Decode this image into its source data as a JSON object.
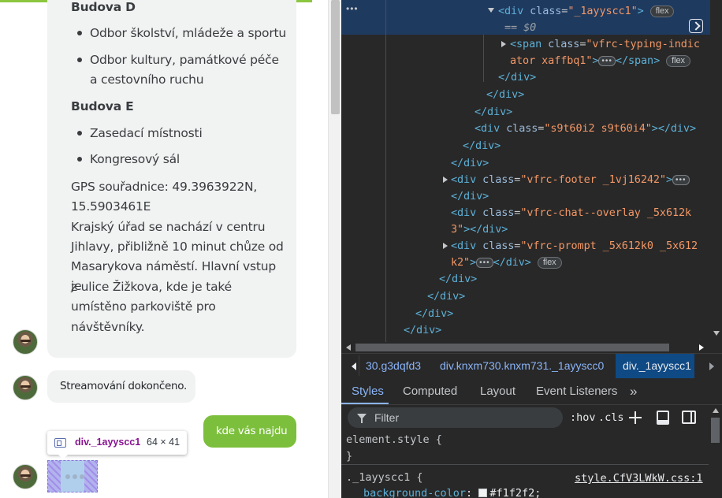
{
  "chat": {
    "bubble1": {
      "heading_d": "Budova D",
      "d_items": [
        "Odbor školství, mládeže a sportu",
        "Odbor kultury, památkové péče",
        "a cestovního ruchu"
      ],
      "heading_e": "Budova E",
      "e_items": [
        "Zasedací místnosti",
        "Kongresový sál"
      ],
      "paragraph_lines": [
        "GPS souřadnice: 49.3963922N,",
        "15.5903461E",
        "Krajský úřad se nachází v centru",
        "Jihlavy, přibližně 10 minut chůze od",
        "Masarykova náměstí. Hlavní vstup je",
        "z ulice Žižkova, kde je také",
        "umístěno parkoviště pro",
        "návštěvníky."
      ]
    },
    "bubble2": "Streamování dokončeno.",
    "user_message": "kde vás najdu",
    "tooltip": {
      "name": "div._1ayyscc1",
      "size": "64 × 41"
    }
  },
  "devtools": {
    "dom": {
      "l1_tag_open": "<div ",
      "l1_attr": "class",
      "l1_val": "\"_1ayyscc1\"",
      "l1_close": ">",
      "l1_badge": "flex",
      "l2": "== $0",
      "l3_open": "<span ",
      "l3_attr": "class",
      "l3_val": "\"vfrc-typing-indic",
      "l4_val": "ator xaffbq1\"",
      "l4_close": "</span>",
      "l4_badge": "flex",
      "close_div": "</div>",
      "l10_open": "<div ",
      "l10_attr": "class",
      "l10_val": "\"s9t60i2 s9t60i4\"",
      "l10_close": "></div>",
      "l13_val": "\"vfrc-footer _1vj16242\"",
      "l15_val": "\"vfrc-chat--overlay _5x612k",
      "l16_val": "3\"",
      "l16_close": "></div>",
      "l17_val": "\"vfrc-prompt _5x612k0 _5x612",
      "l18_val": "k2\"",
      "l18_close": "</div>",
      "l18_badge": "flex",
      "ellipsis_badge": "•••",
      "gutter_ellipsis": "•••"
    },
    "breadcrumbs": [
      "30.g3dqfd3",
      "div.knxm730.knxm731._1ayyscc0",
      "div._1ayyscc1"
    ],
    "tabs": {
      "styles": "Styles",
      "computed": "Computed",
      "layout": "Layout",
      "events": "Event Listeners",
      "more": "»"
    },
    "toolbar": {
      "filter_placeholder": "Filter",
      "hov": ":hov",
      "cls": ".cls"
    },
    "styles": {
      "element_style": "element.style {",
      "element_close": "}",
      "rule_selector": "._1ayyscc1 {",
      "rule_source": "style.CfV3LWkW.css:1",
      "prop_name": "background-color",
      "prop_value": "#f1f2f2;"
    },
    "colors": {
      "selected_row": "#1f3a5f",
      "accent_blue": "#8ab4f8",
      "chat_green": "#7cbf3c",
      "bubble_gray": "#f1f2f2"
    }
  }
}
